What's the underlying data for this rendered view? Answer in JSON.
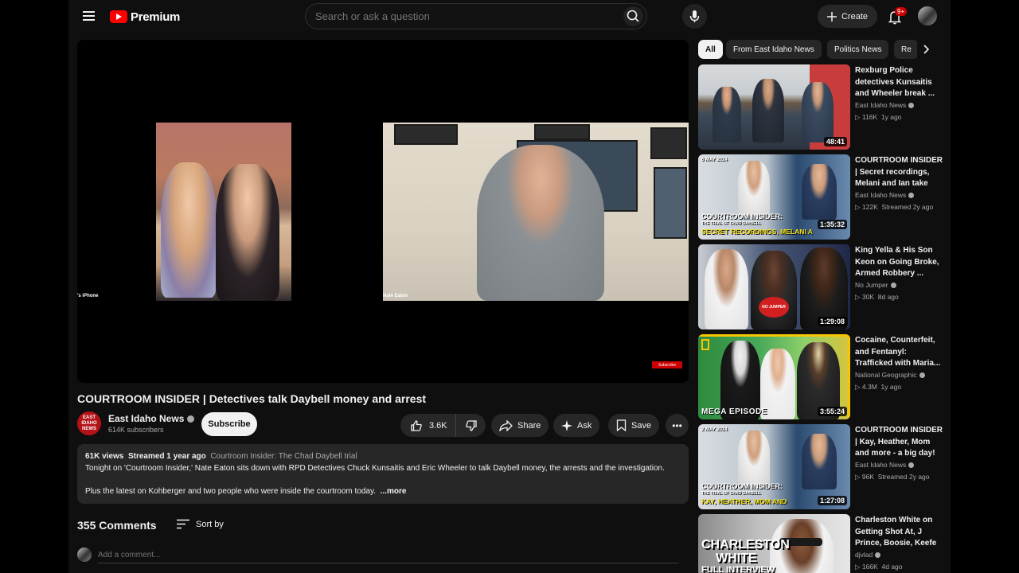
{
  "header": {
    "logo_text": "Premium",
    "search_placeholder": "Search or ask a question",
    "create_label": "Create",
    "notification_count": "9+"
  },
  "video": {
    "title": "COURTROOM INSIDER | Detectives talk Daybell money and arrest",
    "left_cam_label": "'s iPhone",
    "right_cam_label": "Nate Eaton",
    "watermark": "Subscribe"
  },
  "channel": {
    "logo_text": "EAST IDAHO NEWS",
    "name": "East Idaho News",
    "subscribers": "614K subscribers",
    "subscribe_label": "Subscribe"
  },
  "actions": {
    "like_count": "3.6K",
    "share_label": "Share",
    "ask_label": "Ask",
    "save_label": "Save"
  },
  "description": {
    "views": "61K views",
    "streamed": "Streamed 1 year ago",
    "playlist": "Courtroom Insider: The Chad Daybell trial",
    "line1": "Tonight on 'Courtroom Insider,' Nate Eaton sits down with RPD Detectives Chuck Kunsaitis and Eric Wheeler to talk Daybell money, the arrests and the investigation.",
    "line2": "Plus the latest on Kohberger and two people who were inside the courtroom today.",
    "more": "...more"
  },
  "comments": {
    "count_label": "355 Comments",
    "sort_label": "Sort by",
    "placeholder": "Add a comment..."
  },
  "chips": [
    "All",
    "From East Idaho News",
    "Politics News",
    "Re"
  ],
  "recommendations": [
    {
      "title": "Rexburg Police detectives Kunsaitis and Wheeler break ...",
      "channel": "East Idaho News",
      "views": "116K",
      "age": "1y ago",
      "duration": "48:41"
    },
    {
      "title": "COURTROOM INSIDER | Secret recordings, Melani and Ian take th...",
      "channel": "East Idaho News",
      "views": "122K",
      "age": "Streamed 2y ago",
      "duration": "1:35:32",
      "thumb_date": "6 MAY 2024",
      "thumb_line1": "COURTROOM INSIDER:",
      "thumb_line2": "THE TRIAL OF CHAD DAYBELL",
      "thumb_line3": "SECRET RECORDINGS, MELANI A"
    },
    {
      "title": "King Yella & His Son Keon on Going Broke, Armed Robbery ...",
      "channel": "No Jumper",
      "views": "30K",
      "age": "8d ago",
      "duration": "1:29:08",
      "thumb_badge": "NO JUMPER"
    },
    {
      "title": "Cocaine, Counterfeit, and Fentanyl: Trafficked with Maria...",
      "channel": "National Geographic",
      "views": "4.3M",
      "age": "1y ago",
      "duration": "3:55:24",
      "thumb_line1": "MEGA EPISODE"
    },
    {
      "title": "COURTROOM INSIDER | Kay, Heather, Mom and more - a big day!",
      "channel": "East Idaho News",
      "views": "96K",
      "age": "Streamed 2y ago",
      "duration": "1:27:08",
      "thumb_date": "2 MAY 2024",
      "thumb_line1": "COURTROOM INSIDER:",
      "thumb_line2": "THE TRIAL OF CHAD DAYBELL",
      "thumb_line3": "KAY, HEATHER, MOM AND"
    },
    {
      "title": "Charleston White on Getting Shot At, J Prince, Boosie, Keefe ...",
      "channel": "djvlad",
      "views": "166K",
      "age": "4d ago",
      "thumb_line1": "CHARLESTON",
      "thumb_line2": "WHITE",
      "thumb_line3": "FULL INTERVIEW"
    }
  ]
}
